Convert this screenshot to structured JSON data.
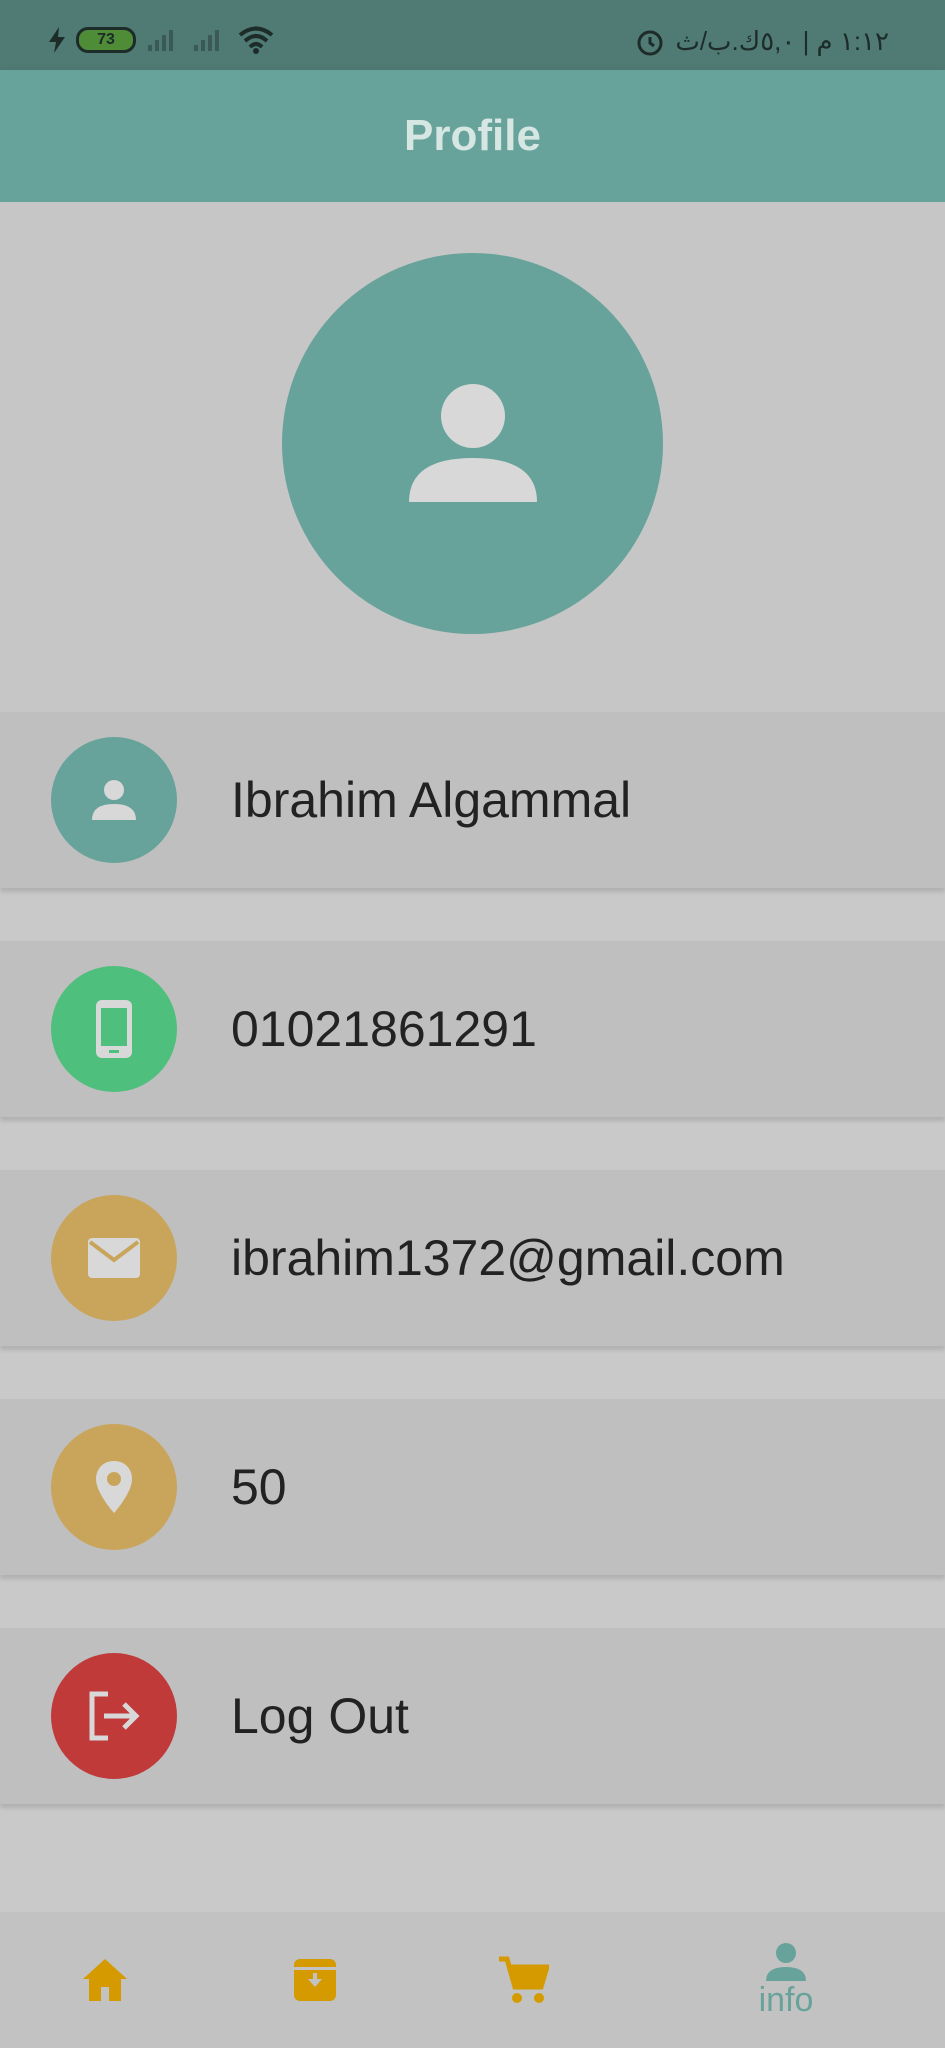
{
  "status_bar": {
    "battery_level": "73",
    "time_text": "١:١٢ م | ٥,٠ك.ب/ث"
  },
  "app_bar": {
    "title": "Profile"
  },
  "profile_items": [
    {
      "label": "Ibrahim Algammal",
      "icon": "person-icon",
      "color": "#67a39a"
    },
    {
      "label": "01021861291",
      "icon": "phone-icon",
      "color": "#4fbf7d"
    },
    {
      "label": "ibrahim1372@gmail.com",
      "icon": "email-icon",
      "color": "#c9a55c"
    },
    {
      "label": "50",
      "icon": "location-pin-icon",
      "color": "#c9a55c"
    },
    {
      "label": "Log Out",
      "icon": "logout-icon",
      "color": "#c13a3a"
    }
  ],
  "bottom_nav": {
    "items": [
      "home-icon",
      "archive-download-icon",
      "cart-icon",
      "person-icon"
    ],
    "active_label": "info",
    "accent_color": "#d49a00",
    "active_color": "#67a39a"
  }
}
